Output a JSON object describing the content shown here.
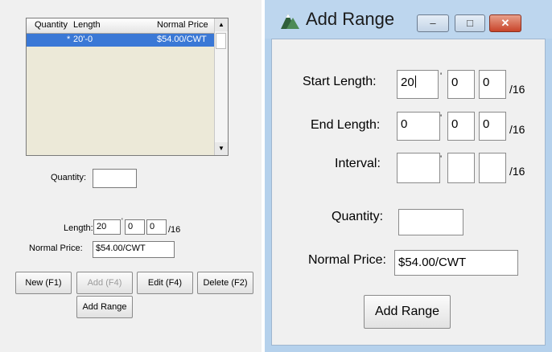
{
  "left": {
    "list": {
      "columns": [
        "Quantity",
        "Length",
        "Normal Price"
      ],
      "rows": [
        {
          "quantity": "*",
          "length": "20'-0",
          "normal_price": "$54.00/CWT"
        }
      ],
      "scroll_up": "▲",
      "scroll_down": "▼"
    },
    "quantity": {
      "label": "Quantity:",
      "value": ""
    },
    "length": {
      "label": "Length:",
      "feet": "20",
      "mark": "'",
      "inches": "0",
      "sixteenths": "0",
      "unit": "/16"
    },
    "normal_price": {
      "label": "Normal Price:",
      "value": "$54.00/CWT"
    },
    "buttons": {
      "new": "New (F1)",
      "add": "Add (F4)",
      "edit": "Edit (F4)",
      "delete": "Delete (F2)",
      "add_range": "Add Range"
    }
  },
  "dialog": {
    "title": "Add Range",
    "window_buttons": {
      "minimize": "–",
      "maximize": "□",
      "close": "✕"
    },
    "start_length": {
      "label": "Start Length:",
      "feet": "20",
      "mark": "'",
      "inches": "0",
      "sixteenths": "0",
      "unit": "/16"
    },
    "end_length": {
      "label": "End Length:",
      "feet": "0",
      "mark": "'",
      "inches": "0",
      "sixteenths": "0",
      "unit": "/16"
    },
    "interval": {
      "label": "Interval:",
      "feet": "",
      "mark": "'",
      "inches": "",
      "sixteenths": "",
      "unit": "/16"
    },
    "quantity": {
      "label": "Quantity:",
      "value": ""
    },
    "normal_price": {
      "label": "Normal Price:",
      "value": "$54.00/CWT"
    },
    "add_range_button": "Add Range"
  }
}
